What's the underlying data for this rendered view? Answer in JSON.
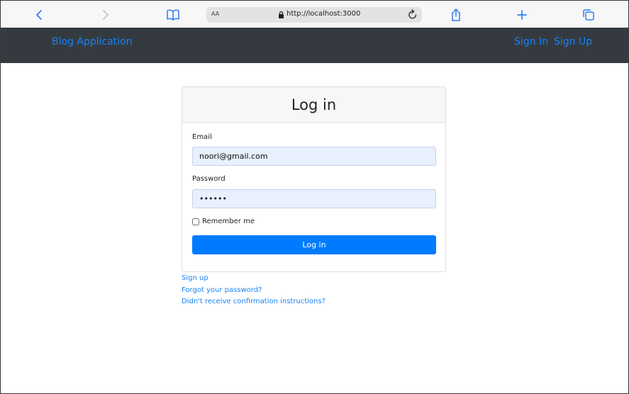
{
  "browser": {
    "address_text_size_label": "AA",
    "url": "http://localhost:3000",
    "icons": {
      "back": "chevron-left-icon",
      "forward": "chevron-right-icon",
      "reader": "book-icon",
      "lock": "lock-icon",
      "reload": "reload-icon",
      "share": "share-icon",
      "new_tab": "plus-icon",
      "tabs": "tabs-icon"
    },
    "accent_color": "#2e7cf6"
  },
  "navbar": {
    "brand": "Blog Application",
    "links": [
      {
        "label": "Sign In"
      },
      {
        "label": "Sign Up"
      }
    ],
    "background": "#343a40",
    "link_color": "#1a82f3"
  },
  "login_form": {
    "title": "Log in",
    "email_label": "Email",
    "email_value": "noori@gmail.com",
    "password_label": "Password",
    "password_value": "••••••",
    "remember_label": "Remember me",
    "remember_checked": false,
    "submit_label": "Log in",
    "button_color": "#007bff",
    "autofill_color": "#e8f0fe"
  },
  "footer_links": [
    {
      "label": "Sign up"
    },
    {
      "label": "Forgot your password?"
    },
    {
      "label": "Didn't receive confirmation instructions?"
    }
  ]
}
